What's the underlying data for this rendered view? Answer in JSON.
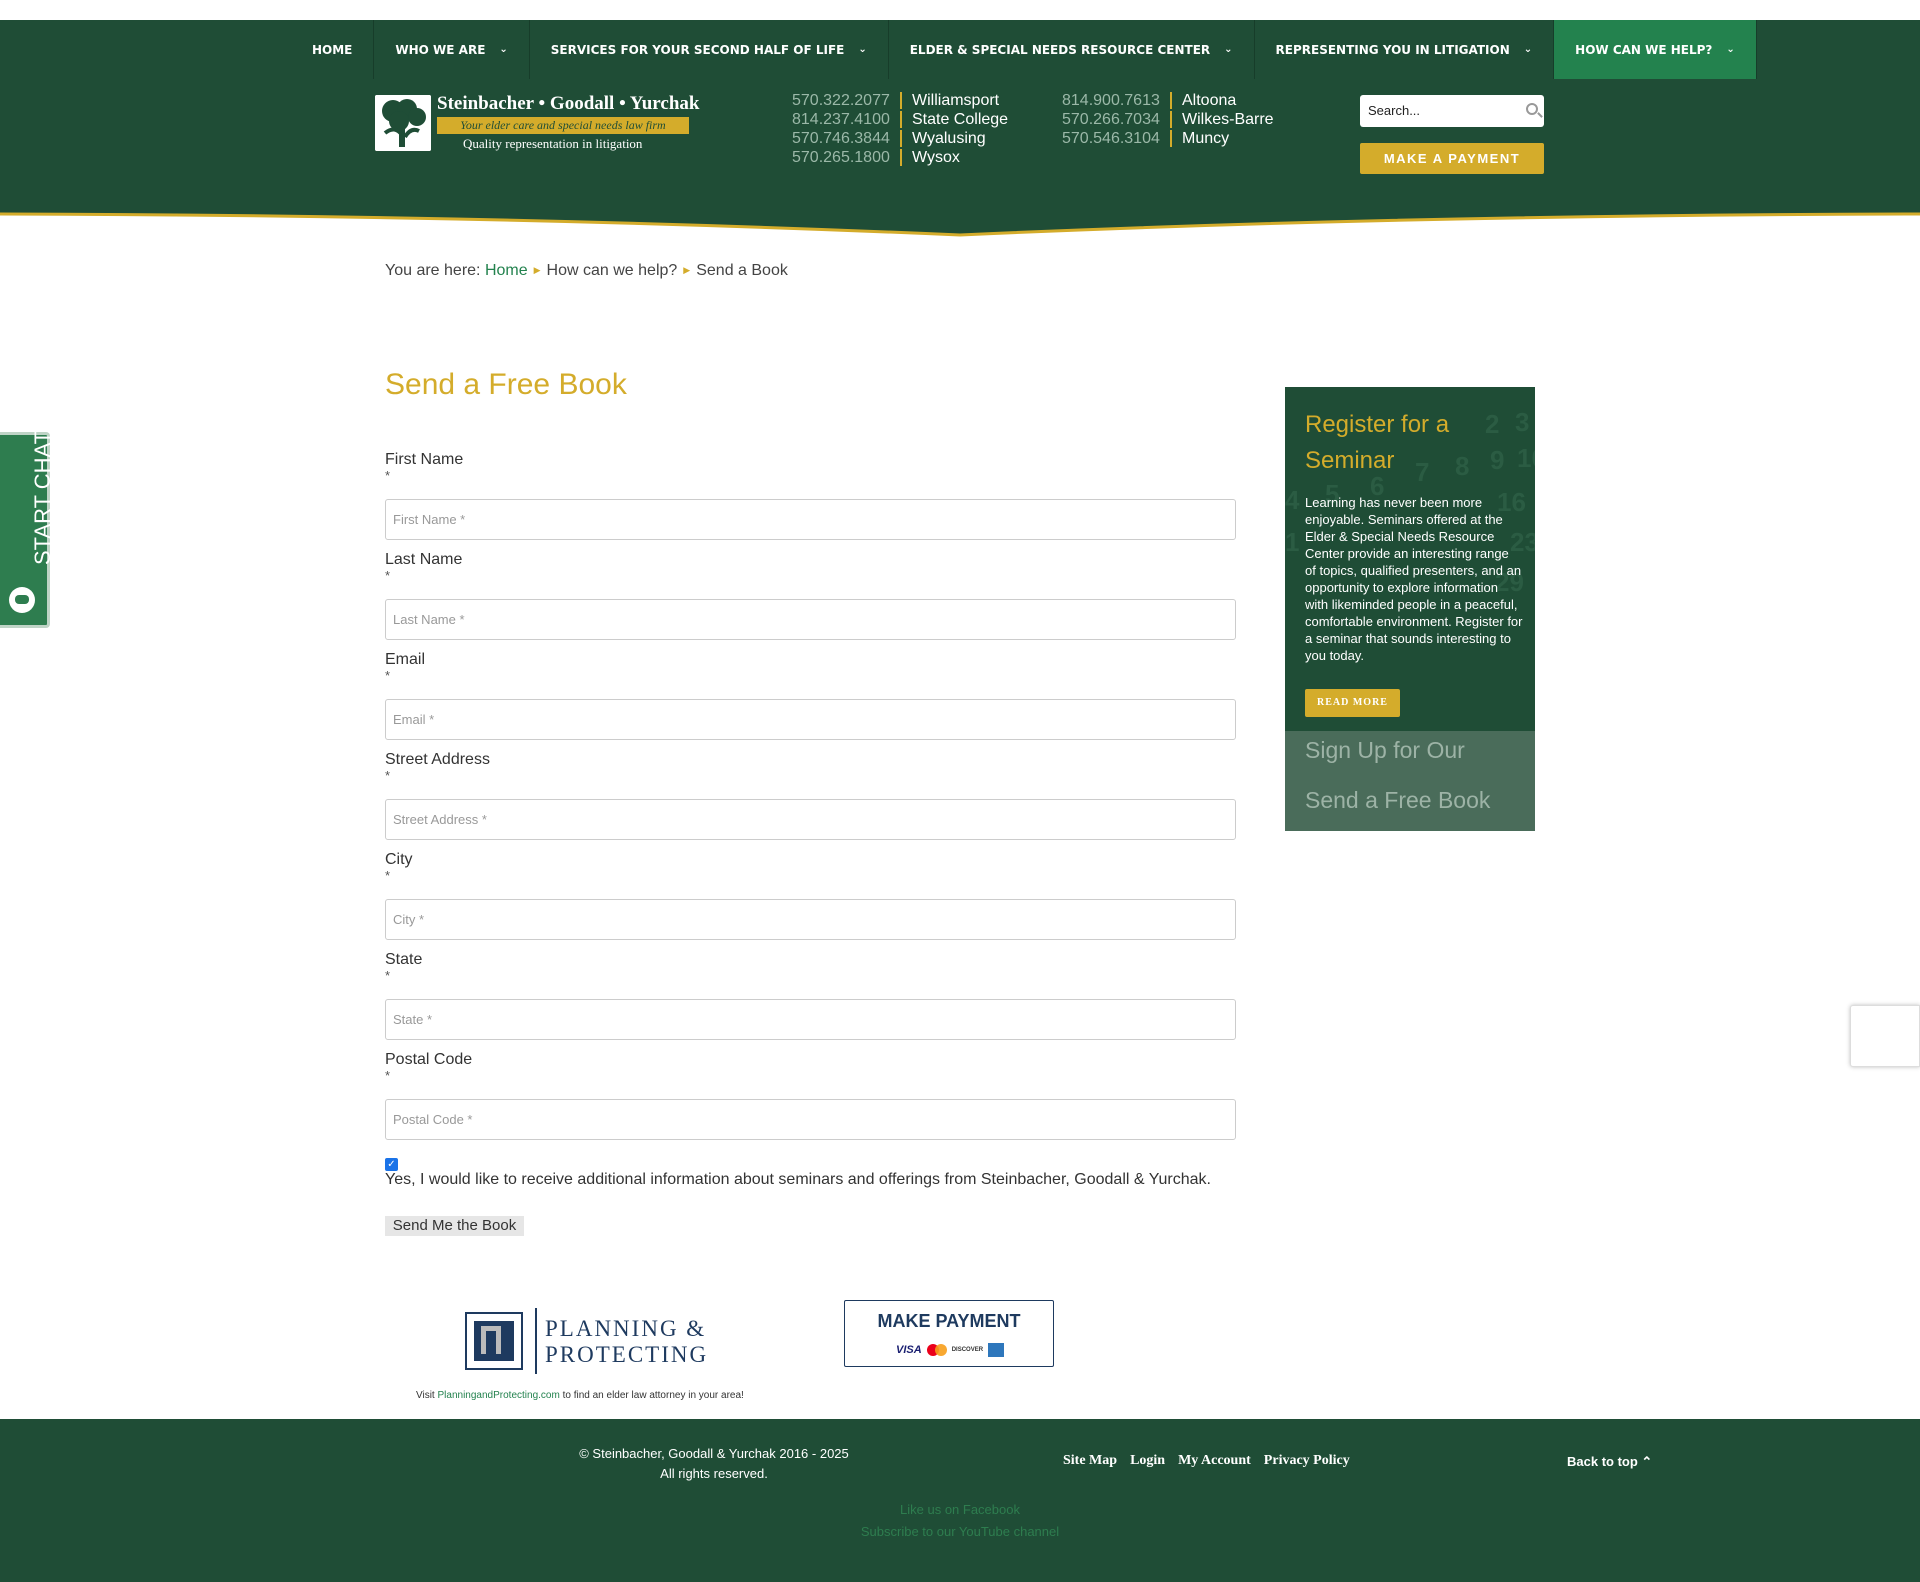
{
  "nav": {
    "items": [
      {
        "label": "HOME",
        "dropdown": false
      },
      {
        "label": "WHO WE ARE",
        "dropdown": true
      },
      {
        "label": "SERVICES FOR YOUR SECOND HALF OF LIFE",
        "dropdown": true
      },
      {
        "label": "ELDER & SPECIAL NEEDS RESOURCE CENTER",
        "dropdown": true
      },
      {
        "label": "REPRESENTING YOU IN LITIGATION",
        "dropdown": true
      },
      {
        "label": "HOW CAN WE HELP?",
        "dropdown": true,
        "active": true
      }
    ]
  },
  "logo": {
    "name": "Steinbacher • Goodall • Yurchak",
    "tagline": "Your elder care and special needs law firm",
    "subline": "Quality representation in litigation"
  },
  "phones": {
    "col1": [
      {
        "number": "570.322.2077",
        "city": "Williamsport"
      },
      {
        "number": "814.237.4100",
        "city": "State College"
      },
      {
        "number": "570.746.3844",
        "city": "Wyalusing"
      },
      {
        "number": "570.265.1800",
        "city": "Wysox"
      }
    ],
    "col2": [
      {
        "number": "814.900.7613",
        "city": "Altoona"
      },
      {
        "number": "570.266.7034",
        "city": "Wilkes-Barre"
      },
      {
        "number": "570.546.3104",
        "city": "Muncy"
      }
    ]
  },
  "search": {
    "placeholder": "Search..."
  },
  "payment_button": "MAKE A PAYMENT",
  "breadcrumb": {
    "prefix": "You are here:",
    "items": [
      "Home",
      "How can we help?",
      "Send a Book"
    ]
  },
  "page_title": "Send a Free Book",
  "form": {
    "fields": [
      {
        "label": "First Name",
        "required": "*",
        "placeholder": "First Name *"
      },
      {
        "label": "Last Name",
        "required": "*",
        "placeholder": "Last Name *"
      },
      {
        "label": "Email",
        "required": "*",
        "placeholder": "Email *"
      },
      {
        "label": "Street Address",
        "required": "*",
        "placeholder": "Street Address *"
      },
      {
        "label": "City",
        "required": "*",
        "placeholder": "City *"
      },
      {
        "label": "State",
        "required": "*",
        "placeholder": "State *"
      },
      {
        "label": "Postal Code",
        "required": "*",
        "placeholder": "Postal Code *"
      }
    ],
    "opt_in_checked": true,
    "opt_in_label": "Yes, I would like to receive additional information about seminars and offerings from Steinbacher, Goodall & Yurchak.",
    "submit_label": "Send Me the Book"
  },
  "sidebar": {
    "title": "Register for a Seminar",
    "text": "Learning has never been more enjoyable. Seminars offered at the Elder & Special Needs Resource Center provide an interesting range of topics, qualified presenters, and an opportunity to explore information with likeminded people in a peaceful, comfortable environment. Register for a seminar that sounds interesting to you today.",
    "button": "READ MORE",
    "link1": "Sign Up for Our",
    "link2": "Send a Free Book"
  },
  "chat": {
    "label": "START CHAT"
  },
  "partners": {
    "pp_line1": "PLANNING &",
    "pp_line2": "PROTECTING",
    "visit_prefix": "Visit",
    "visit_link": "PlanningandProtecting.com",
    "visit_suffix": "to find an elder law attorney in your area!",
    "make_payment": "MAKE PAYMENT",
    "card_visa": "VISA",
    "card_discover": "DISCOVER"
  },
  "footer": {
    "copyright": "© Steinbacher, Goodall & Yurchak 2016 - 2025",
    "rights": "All rights reserved.",
    "links": [
      "Site Map",
      "Login",
      "My Account",
      "Privacy Policy"
    ],
    "back_to_top": "Back to top",
    "facebook": "Like us on Facebook",
    "youtube": "Subscribe to our YouTube channel"
  },
  "colors": {
    "brand_green": "#1f4d36",
    "active_green": "#23824e",
    "gold": "#d4ac2b"
  }
}
